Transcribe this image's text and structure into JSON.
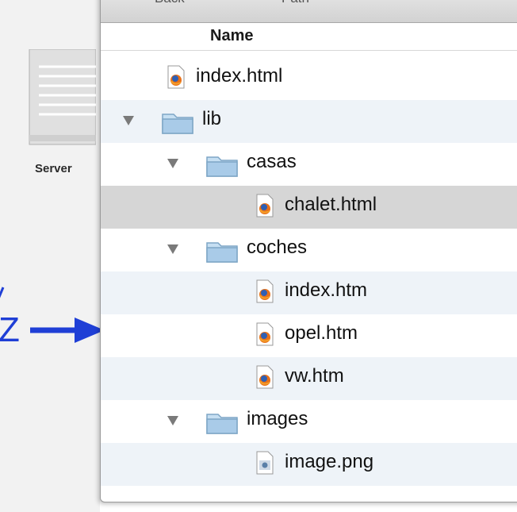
{
  "desktop": {
    "server_label": "Server",
    "annotation_letter": "Z"
  },
  "toolbar": {
    "back_label": "Back",
    "path_label": "Path"
  },
  "columns": {
    "name_header": "Name"
  },
  "files": [
    {
      "name": "index.html",
      "type": "html",
      "depth": 0
    },
    {
      "name": "lib",
      "type": "folder",
      "depth": 0,
      "expanded": true
    },
    {
      "name": "casas",
      "type": "folder",
      "depth": 1,
      "expanded": true
    },
    {
      "name": "chalet.html",
      "type": "html",
      "depth": 2,
      "selected": true
    },
    {
      "name": "coches",
      "type": "folder",
      "depth": 1,
      "expanded": true
    },
    {
      "name": "index.htm",
      "type": "html",
      "depth": 2
    },
    {
      "name": "opel.htm",
      "type": "html",
      "depth": 2
    },
    {
      "name": "vw.htm",
      "type": "html",
      "depth": 2
    },
    {
      "name": "images",
      "type": "folder",
      "depth": 1,
      "expanded": true
    },
    {
      "name": "image.png",
      "type": "image",
      "depth": 2
    }
  ],
  "colors": {
    "annotation": "#1f3fd6",
    "folder": "#a9cbe8",
    "selected_row": "#d6d6d6",
    "alt_row": "#eef3f8"
  }
}
